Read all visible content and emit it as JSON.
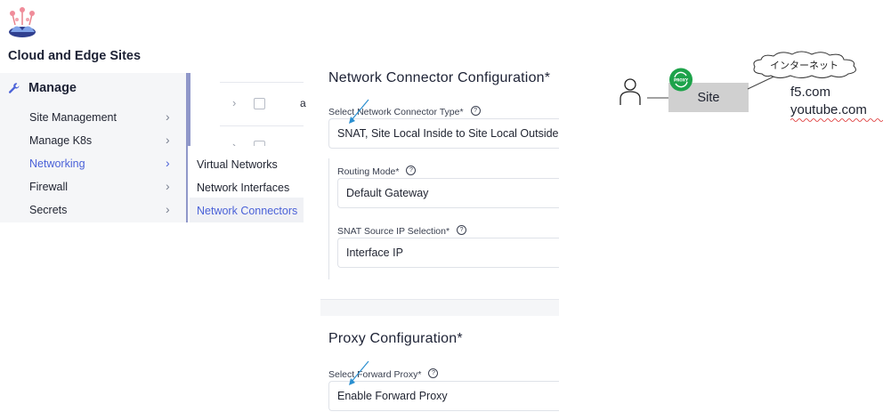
{
  "app": {
    "title": "Cloud and Edge Sites"
  },
  "nav": {
    "section_label": "Manage",
    "items": [
      {
        "label": "Site Management",
        "active": false
      },
      {
        "label": "Manage K8s",
        "active": false
      },
      {
        "label": "Networking",
        "active": true
      },
      {
        "label": "Firewall",
        "active": false
      },
      {
        "label": "Secrets",
        "active": false
      }
    ],
    "submenu": [
      {
        "label": "Virtual Networks",
        "active": false
      },
      {
        "label": "Network Interfaces",
        "active": false
      },
      {
        "label": "Network Connectors",
        "active": true
      }
    ]
  },
  "background_list": {
    "row_text": "a"
  },
  "form": {
    "network_connector": {
      "title": "Network Connector Configuration*",
      "type_label": "Select Network Connector Type*",
      "type_value": "SNAT, Site Local Inside to Site Local Outside",
      "routing_label": "Routing Mode*",
      "routing_value": "Default Gateway",
      "snat_label": "SNAT Source IP Selection*",
      "snat_value": "Interface IP"
    },
    "proxy": {
      "title": "Proxy Configuration*",
      "forward_label": "Select Forward Proxy*",
      "forward_value": "Enable Forward Proxy"
    },
    "help_glyph": "?"
  },
  "diagram": {
    "site_label": "Site",
    "internet_label": "インターネット",
    "proxy_badge_text": "PROXY",
    "destinations": [
      "f5.com",
      "youtube.com"
    ]
  },
  "colors": {
    "accent": "#4b62d8",
    "arrow": "#2a8fd0",
    "proxy_green": "#1ea34a",
    "site_gray": "#d0d0d0"
  }
}
